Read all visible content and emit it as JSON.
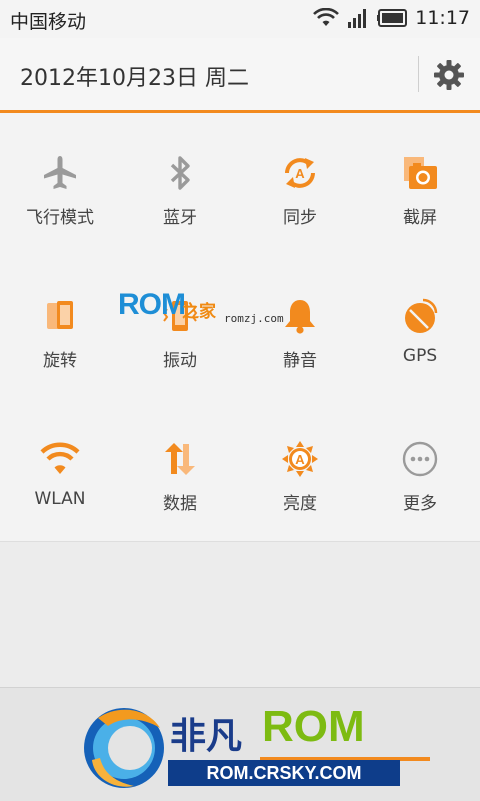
{
  "status_bar": {
    "carrier": "中国移动",
    "time": "11:17",
    "icons": [
      "wifi-icon",
      "signal-icon",
      "battery-icon"
    ]
  },
  "header": {
    "date": "2012年10月23日 周二",
    "settings_icon": "gear-icon"
  },
  "toggles": [
    {
      "label": "飞行模式",
      "icon": "airplane-icon",
      "active": false
    },
    {
      "label": "蓝牙",
      "icon": "bluetooth-icon",
      "active": false
    },
    {
      "label": "同步",
      "icon": "sync-icon",
      "active": true
    },
    {
      "label": "截屏",
      "icon": "screenshot-icon",
      "active": true
    },
    {
      "label": "旋转",
      "icon": "rotate-icon",
      "active": true
    },
    {
      "label": "振动",
      "icon": "vibrate-icon",
      "active": true
    },
    {
      "label": "静音",
      "icon": "bell-icon",
      "active": true
    },
    {
      "label": "GPS",
      "icon": "gps-icon",
      "active": true
    },
    {
      "label": "WLAN",
      "icon": "wifi-icon",
      "active": true
    },
    {
      "label": "数据",
      "icon": "data-icon",
      "active": true
    },
    {
      "label": "亮度",
      "icon": "brightness-icon",
      "active": true
    },
    {
      "label": "更多",
      "icon": "more-icon",
      "active": false
    }
  ],
  "colors": {
    "accent": "#f28a1e",
    "inactive": "#9a9a9a"
  },
  "watermark": {
    "brand": "ROM",
    "brand_suffix": "之家",
    "url": "romzj.com"
  },
  "logo": {
    "name_cn": "非凡",
    "name_en": "ROM",
    "url": "ROM.CRSKY.COM"
  }
}
